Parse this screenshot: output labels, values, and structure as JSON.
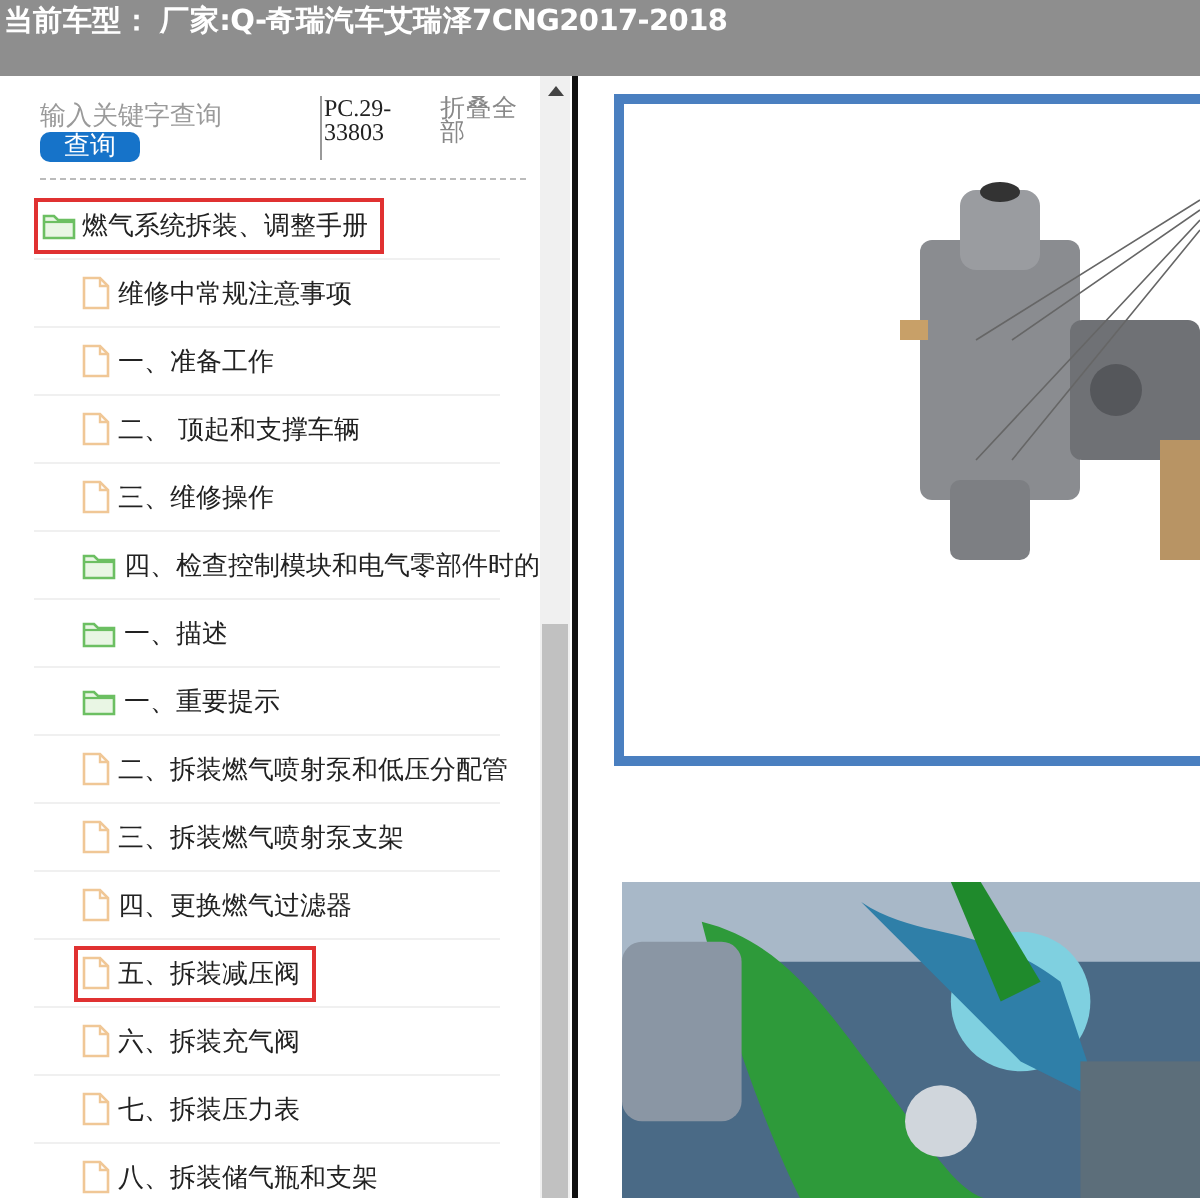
{
  "header": {
    "title": "当前车型：  厂家:Q-奇瑞汽车艾瑞泽7CNG2017-2018"
  },
  "search": {
    "placeholder": "输入关键字查询",
    "button": "查询",
    "code": "PC.29-33803",
    "collapse": "折叠全部"
  },
  "tree": [
    {
      "label": "燃气系统拆装、调整手册",
      "kind": "folder",
      "highlighted": true,
      "children": [
        {
          "label": "维修中常规注意事项",
          "kind": "file",
          "highlighted": false
        },
        {
          "label": "一、准备工作",
          "kind": "file",
          "highlighted": false
        },
        {
          "label": "二、 顶起和支撑车辆",
          "kind": "file",
          "highlighted": false
        },
        {
          "label": "三、维修操作",
          "kind": "file",
          "highlighted": false
        },
        {
          "label": "四、检查控制模块和电气零部件时的",
          "kind": "folder",
          "highlighted": false
        },
        {
          "label": "一、描述",
          "kind": "folder",
          "highlighted": false
        },
        {
          "label": "一、重要提示",
          "kind": "folder",
          "highlighted": false
        },
        {
          "label": "二、拆装燃气喷射泵和低压分配管",
          "kind": "file",
          "highlighted": false
        },
        {
          "label": "三、拆装燃气喷射泵支架",
          "kind": "file",
          "highlighted": false
        },
        {
          "label": "四、更换燃气过滤器",
          "kind": "file",
          "highlighted": false
        },
        {
          "label": "五、拆装减压阀",
          "kind": "file",
          "highlighted": true
        },
        {
          "label": "六、拆装充气阀",
          "kind": "file",
          "highlighted": false
        },
        {
          "label": "七、拆装压力表",
          "kind": "file",
          "highlighted": false
        },
        {
          "label": "八、拆装储气瓶和支架",
          "kind": "file",
          "highlighted": false
        }
      ]
    }
  ]
}
